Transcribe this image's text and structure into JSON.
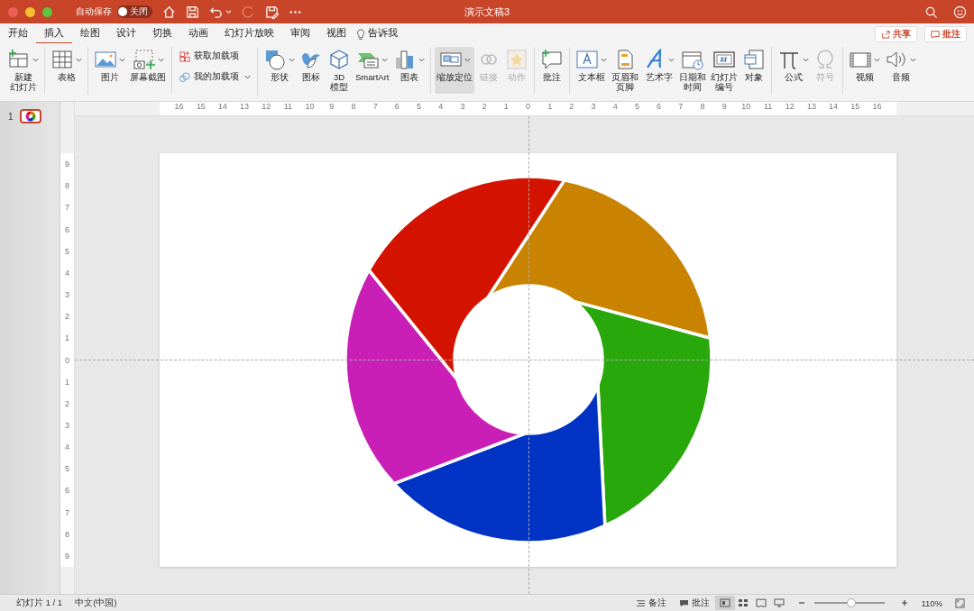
{
  "window": {
    "title": "演示文稿3",
    "autosave": {
      "label": "自动保存",
      "on": false,
      "state_text": "关闭"
    }
  },
  "tabs": [
    {
      "label": "开始",
      "selected": false
    },
    {
      "label": "插入",
      "selected": true
    },
    {
      "label": "绘图",
      "selected": false
    },
    {
      "label": "设计",
      "selected": false
    },
    {
      "label": "切换",
      "selected": false
    },
    {
      "label": "动画",
      "selected": false
    },
    {
      "label": "幻灯片放映",
      "selected": false
    },
    {
      "label": "审阅",
      "selected": false
    },
    {
      "label": "视图",
      "selected": false
    }
  ],
  "tell_me": "告诉我",
  "top_buttons": [
    {
      "label": "共享"
    },
    {
      "label": "批注"
    }
  ],
  "ribbon": [
    {
      "items": [
        {
          "kind": "large",
          "lines": [
            "新建",
            "幻灯片"
          ],
          "dropdown": true,
          "disabled": false,
          "pressed": false
        }
      ]
    },
    {
      "items": [
        {
          "kind": "large",
          "lines": [
            "表格"
          ],
          "dropdown": true,
          "disabled": false,
          "pressed": false
        }
      ]
    },
    {
      "items": [
        {
          "kind": "large",
          "lines": [
            "图片"
          ],
          "dropdown": true,
          "disabled": false,
          "pressed": false
        },
        {
          "kind": "large",
          "lines": [
            "屏幕截图"
          ],
          "dropdown": true,
          "disabled": false,
          "pressed": false
        }
      ]
    },
    {
      "items": [
        {
          "kind": "small",
          "lines": [
            "获取加载项"
          ],
          "dropdown": false,
          "disabled": false,
          "pressed": false
        },
        {
          "kind": "small",
          "lines": [
            "我的加载项"
          ],
          "dropdown": true,
          "disabled": false,
          "pressed": false
        }
      ]
    },
    {
      "items": [
        {
          "kind": "large",
          "lines": [
            "形状"
          ],
          "dropdown": true,
          "disabled": false,
          "pressed": false
        },
        {
          "kind": "large",
          "lines": [
            "图标"
          ],
          "dropdown": false,
          "disabled": false,
          "pressed": false
        },
        {
          "kind": "large",
          "lines": [
            "3D",
            "模型"
          ],
          "dropdown": false,
          "disabled": false,
          "pressed": false
        },
        {
          "kind": "large",
          "lines": [
            "SmartArt"
          ],
          "dropdown": true,
          "disabled": false,
          "pressed": false
        },
        {
          "kind": "large",
          "lines": [
            "图表"
          ],
          "dropdown": true,
          "disabled": false,
          "pressed": false
        }
      ]
    },
    {
      "items": [
        {
          "kind": "large",
          "lines": [
            "缩放定位"
          ],
          "dropdown": true,
          "disabled": false,
          "pressed": true
        },
        {
          "kind": "large",
          "lines": [
            "链接"
          ],
          "dropdown": false,
          "disabled": true,
          "pressed": false
        },
        {
          "kind": "large",
          "lines": [
            "动作"
          ],
          "dropdown": false,
          "disabled": true,
          "pressed": false
        }
      ]
    },
    {
      "items": [
        {
          "kind": "large",
          "lines": [
            "批注"
          ],
          "dropdown": false,
          "disabled": false,
          "pressed": false
        }
      ]
    },
    {
      "items": [
        {
          "kind": "large",
          "lines": [
            "文本框"
          ],
          "dropdown": true,
          "disabled": false,
          "pressed": false
        },
        {
          "kind": "large",
          "lines": [
            "页眉和",
            "页脚"
          ],
          "dropdown": false,
          "disabled": false,
          "pressed": false
        },
        {
          "kind": "large",
          "lines": [
            "艺术字"
          ],
          "dropdown": true,
          "disabled": false,
          "pressed": false
        },
        {
          "kind": "large",
          "lines": [
            "日期和",
            "时间"
          ],
          "dropdown": false,
          "disabled": false,
          "pressed": false
        },
        {
          "kind": "large",
          "lines": [
            "幻灯片",
            "编号"
          ],
          "dropdown": false,
          "disabled": false,
          "pressed": false
        },
        {
          "kind": "large",
          "lines": [
            "对象"
          ],
          "dropdown": false,
          "disabled": false,
          "pressed": false
        }
      ]
    },
    {
      "items": [
        {
          "kind": "large",
          "lines": [
            "公式"
          ],
          "dropdown": true,
          "disabled": false,
          "pressed": false
        },
        {
          "kind": "large",
          "lines": [
            "符号"
          ],
          "dropdown": false,
          "disabled": true,
          "pressed": false
        }
      ]
    },
    {
      "items": [
        {
          "kind": "large",
          "lines": [
            "视频"
          ],
          "dropdown": true,
          "disabled": false,
          "pressed": false
        },
        {
          "kind": "large",
          "lines": [
            "音频"
          ],
          "dropdown": true,
          "disabled": false,
          "pressed": false
        }
      ]
    }
  ],
  "thumbnails": [
    {
      "number": "1",
      "selected": true
    }
  ],
  "ruler_h": [
    "16",
    "15",
    "14",
    "13",
    "12",
    "11",
    "10",
    "9",
    "8",
    "7",
    "6",
    "5",
    "4",
    "3",
    "2",
    "1",
    "0",
    "1",
    "2",
    "3",
    "4",
    "5",
    "6",
    "7",
    "8",
    "9",
    "10",
    "11",
    "12",
    "13",
    "14",
    "15",
    "16"
  ],
  "ruler_v": [
    "9",
    "8",
    "7",
    "6",
    "5",
    "4",
    "3",
    "2",
    "1",
    "0",
    "1",
    "2",
    "3",
    "4",
    "5",
    "6",
    "7",
    "8",
    "9"
  ],
  "status": {
    "slide": "幻灯片 1 / 1",
    "language": "中文(中国)",
    "notes": "备注",
    "comments": "批注",
    "views": [
      {
        "selected": true
      },
      {
        "selected": false
      },
      {
        "selected": false
      },
      {
        "selected": false
      }
    ],
    "zoom": {
      "level": 0.52,
      "text": "110%"
    }
  }
}
